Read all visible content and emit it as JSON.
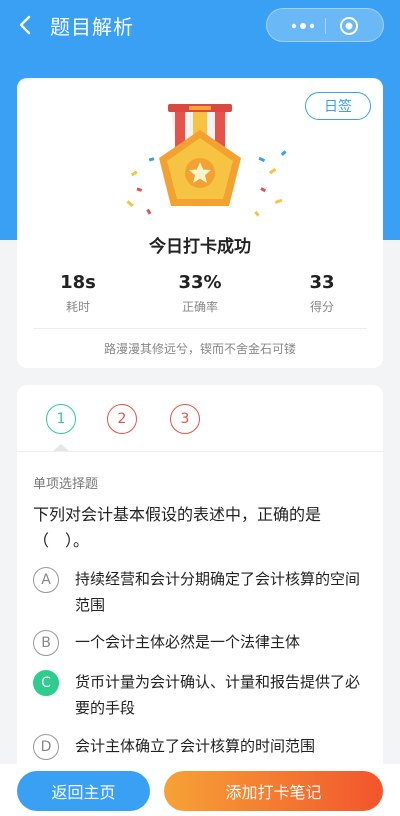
{
  "navbar": {
    "title": "题目解析",
    "back_icon": "chevron-left-icon",
    "more_icon": "more-dots-icon",
    "close_icon": "target-close-icon"
  },
  "summary": {
    "sign_label": "日签",
    "medal_icon": "medal-star-icon",
    "title": "今日打卡成功",
    "stats": [
      {
        "value": "18s",
        "label": "耗时"
      },
      {
        "value": "33%",
        "label": "正确率"
      },
      {
        "value": "33",
        "label": "得分"
      }
    ],
    "motto": "路漫漫其修远兮，锲而不舍金石可镂"
  },
  "question": {
    "tabs": [
      "1",
      "2",
      "3"
    ],
    "type": "单项选择题",
    "text": "下列对会计基本假设的表述中，正确的是（　）。",
    "options": [
      {
        "letter": "A",
        "text": "持续经营和会计分期确定了会计核算的空间范围"
      },
      {
        "letter": "B",
        "text": "一个会计主体必然是一个法律主体"
      },
      {
        "letter": "C",
        "text": "货币计量为会计确认、计量和报告提供了必要的手段"
      },
      {
        "letter": "D",
        "text": "会计主体确立了会计核算的时间范围"
      }
    ],
    "correct": "C"
  },
  "footer": {
    "home_label": "返回主页",
    "note_label": "添加打卡笔记"
  },
  "colors": {
    "primary": "#3aa0f3",
    "correct": "#2ecc8f",
    "wrong": "#e5534b",
    "note_gradient_start": "#f6a236",
    "note_gradient_end": "#f2552c"
  }
}
